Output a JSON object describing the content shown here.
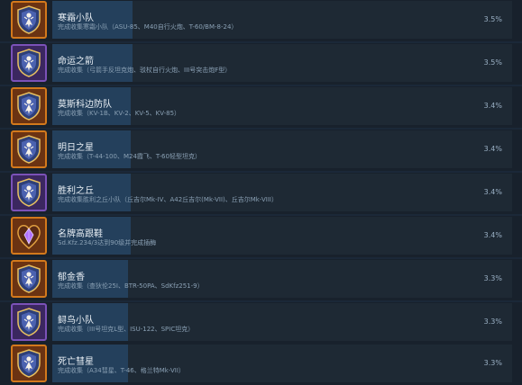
{
  "achievements": [
    {
      "title": "寒霜小队",
      "desc": "完成收集寒霜小队（ASU-85、M40自行火炮、T-60/BM-8-24）",
      "percent": "3.5%",
      "percent_value": 3.5,
      "icon": "shield-emblem-icon",
      "tier": "orange",
      "color": "#d3791c"
    },
    {
      "title": "命运之箭",
      "desc": "完成收集（弓箭手反坦克炮、驳杖自行火炮、III号突击炮F型）",
      "percent": "3.5%",
      "percent_value": 3.5,
      "icon": "shield-emblem-icon",
      "tier": "purple",
      "color": "#7b52b8"
    },
    {
      "title": "莫斯科边防队",
      "desc": "完成收集（KV-1B、KV-2、KV-5、KV-85）",
      "percent": "3.4%",
      "percent_value": 3.4,
      "icon": "shield-emblem-icon",
      "tier": "orange",
      "color": "#d3791c"
    },
    {
      "title": "明日之星",
      "desc": "完成收集（T-44-100、M24霞飞、T-60轻型坦克）",
      "percent": "3.4%",
      "percent_value": 3.4,
      "icon": "shield-emblem-icon",
      "tier": "orange",
      "color": "#d3791c"
    },
    {
      "title": "胜利之丘",
      "desc": "完成收集胜利之丘小队（丘吉尔Mk-IV、A42丘吉尔(Mk-VII)、丘吉尔Mk-VIII）",
      "percent": "3.4%",
      "percent_value": 3.4,
      "icon": "shield-emblem-icon",
      "tier": "purple",
      "color": "#7b52b8"
    },
    {
      "title": "名牌高跟鞋",
      "desc": "Sd.Kfz.234/3达到90级并完成插酶",
      "percent": "3.4%",
      "percent_value": 3.4,
      "icon": "heart-gem-icon",
      "tier": "orange",
      "color": "#d3791c"
    },
    {
      "title": "郁金香",
      "desc": "完成收集（查狄伦25I、BTR-50PA、SdKfz251-9）",
      "percent": "3.3%",
      "percent_value": 3.3,
      "icon": "shield-emblem-icon",
      "tier": "orange",
      "color": "#d3791c"
    },
    {
      "title": "鲟鸟小队",
      "desc": "完成收集（III号坦克L型、ISU-122、SPIC坦克）",
      "percent": "3.3%",
      "percent_value": 3.3,
      "icon": "shield-emblem-icon",
      "tier": "purple",
      "color": "#7b52b8"
    },
    {
      "title": "死亡彗星",
      "desc": "完成收集（A34彗星、T-46、格兰特Mk-VII）",
      "percent": "3.3%",
      "percent_value": 3.3,
      "icon": "shield-emblem-icon",
      "tier": "orange",
      "color": "#d3791c"
    }
  ]
}
